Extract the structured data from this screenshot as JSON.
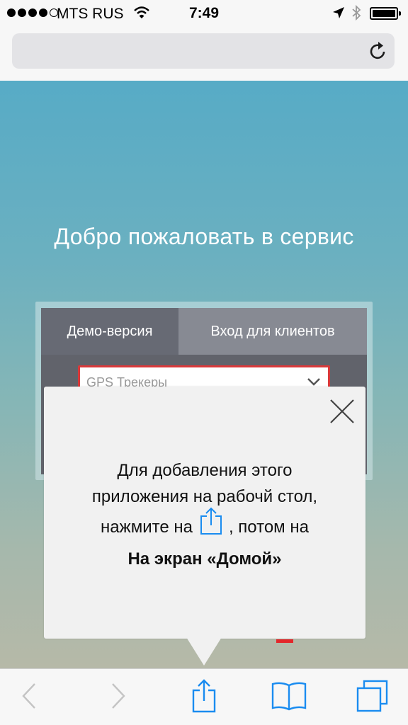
{
  "status_bar": {
    "carrier": "MTS RUS",
    "time": "7:49",
    "signal_bars_filled": 4,
    "signal_bars_total": 5,
    "icons": [
      "wifi-icon",
      "location-arrow-icon",
      "bluetooth-icon",
      "battery-icon"
    ]
  },
  "browser": {
    "url_text": "",
    "reload_icon": "reload-icon"
  },
  "page": {
    "welcome_title": "Добро пожаловать в сервис",
    "tabs": [
      {
        "label": "Демо-версия",
        "active": true
      },
      {
        "label": "Вход для клиентов",
        "active": false
      }
    ],
    "tracker_select": {
      "value": "GPS Трекеры"
    }
  },
  "popup": {
    "line1": "Для добавления этого",
    "line2": "приложения на рабочй стол,",
    "line3_before": "нажмите на",
    "line3_after": ", потом на",
    "line4": "На экран «Домой»",
    "icons": [
      "close-icon",
      "share-icon"
    ]
  },
  "toolbar": {
    "buttons": [
      "back-icon",
      "forward-icon",
      "share-icon",
      "bookmarks-icon",
      "tabs-icon"
    ]
  },
  "colors": {
    "ios_blue": "#1a8cf0",
    "accent_red": "#d9393a",
    "sky_top": "#57abc6",
    "sky_bottom": "#b6b9a8"
  }
}
